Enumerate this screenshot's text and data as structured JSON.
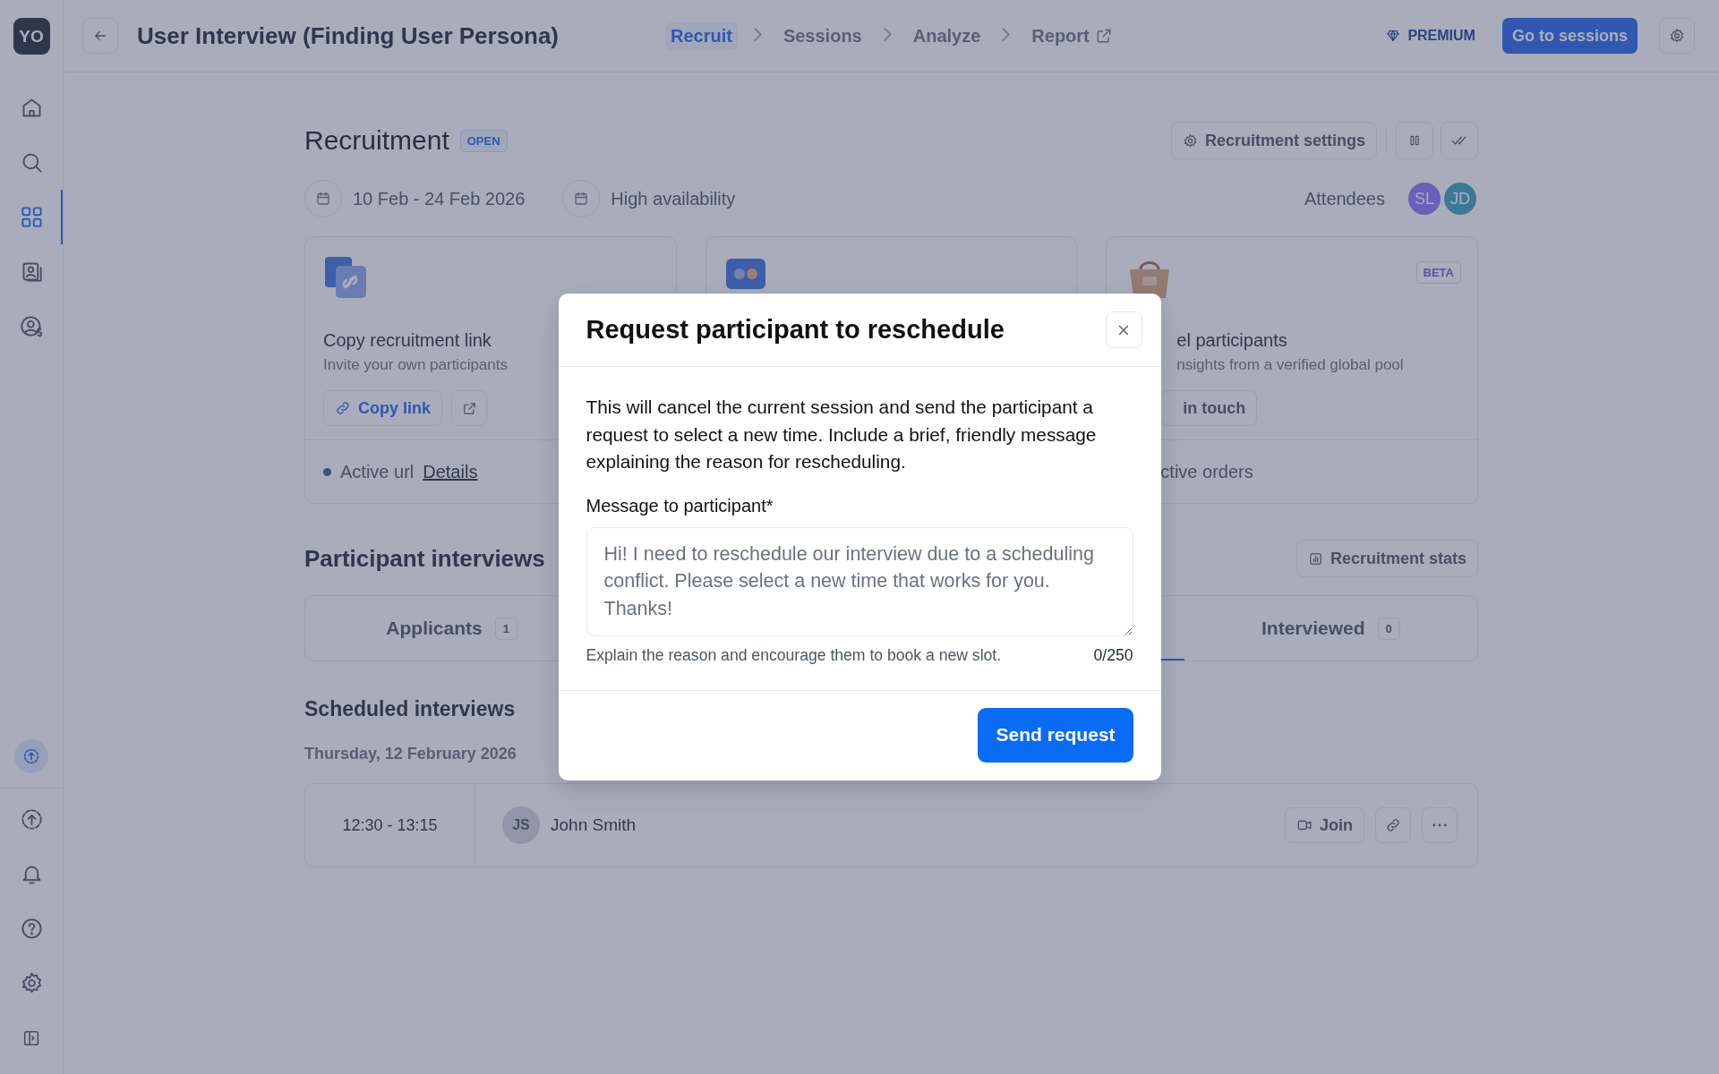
{
  "sidebar": {
    "logo": "YO",
    "items": [
      {
        "kind": "home",
        "selected": false
      },
      {
        "kind": "search",
        "selected": false
      },
      {
        "kind": "grid",
        "selected": true
      },
      {
        "kind": "contacts",
        "selected": false
      },
      {
        "kind": "user-dollar",
        "selected": false
      }
    ],
    "bottom_items": [
      {
        "kind": "upload-badge",
        "selected": false
      },
      {
        "kind": "upload",
        "selected": false
      },
      {
        "kind": "bell",
        "selected": false
      },
      {
        "kind": "help",
        "selected": false
      },
      {
        "kind": "settings",
        "selected": false
      },
      {
        "kind": "panel",
        "selected": false
      }
    ]
  },
  "topbar": {
    "title": "User Interview (Finding User Persona)",
    "steps": [
      {
        "label": "Recruit",
        "selected": true,
        "external": false
      },
      {
        "label": "Sessions",
        "selected": false,
        "external": false
      },
      {
        "label": "Analyze",
        "selected": false,
        "external": false
      },
      {
        "label": "Report",
        "selected": false,
        "external": true
      }
    ],
    "premium": "PREMIUM",
    "primary_button": "Go to sessions"
  },
  "recruitment": {
    "title": "Recruitment",
    "status": "OPEN",
    "settings_button": "Recruitment settings",
    "dates": "10 Feb - 24 Feb 2026",
    "availability": "High availability",
    "attendees_label": "Attendees",
    "attendees": [
      {
        "initials": "SL",
        "color": "#6a60b8"
      },
      {
        "initials": "JD",
        "color": "#3e7898"
      }
    ],
    "cards": [
      {
        "kind": "link",
        "title": "Copy recruitment link",
        "subtitle": "Invite your own participants",
        "button": "Copy link",
        "footer": "Active url",
        "footer_link": "Details"
      },
      {
        "kind": "hidden"
      },
      {
        "kind": "panel",
        "badge": "BETA",
        "title": "el participants",
        "subtitle": "nsights from a verified global pool",
        "button": "in touch",
        "footer": "ctive orders"
      }
    ]
  },
  "interviews": {
    "title": "Participant interviews",
    "stats_button": "Recruitment stats",
    "tabs": [
      {
        "label": "Applicants",
        "count": "1",
        "selected": false
      },
      {
        "selected": true
      },
      {
        "label": "Interviewed",
        "count": "0",
        "selected": false
      }
    ],
    "scheduled_title": "Scheduled interviews",
    "date": "Thursday, 12 February 2026",
    "rows": [
      {
        "time": "12:30 - 13:15",
        "initials": "JS",
        "name": "John Smith",
        "join": "Join"
      }
    ]
  },
  "modal": {
    "title": "Request participant to reschedule",
    "description": "This will cancel the current session and send the participant a request to select a new time. Include a brief, friendly message explaining the reason for rescheduling.",
    "field_label": "Message to participant",
    "required_mark": "*",
    "placeholder": "Hi! I need to reschedule our interview due to a scheduling conflict. Please select a new time that works for you. Thanks!",
    "hint": "Explain the reason and encourage them to book a new slot.",
    "counter": "0/250",
    "submit": "Send request"
  }
}
